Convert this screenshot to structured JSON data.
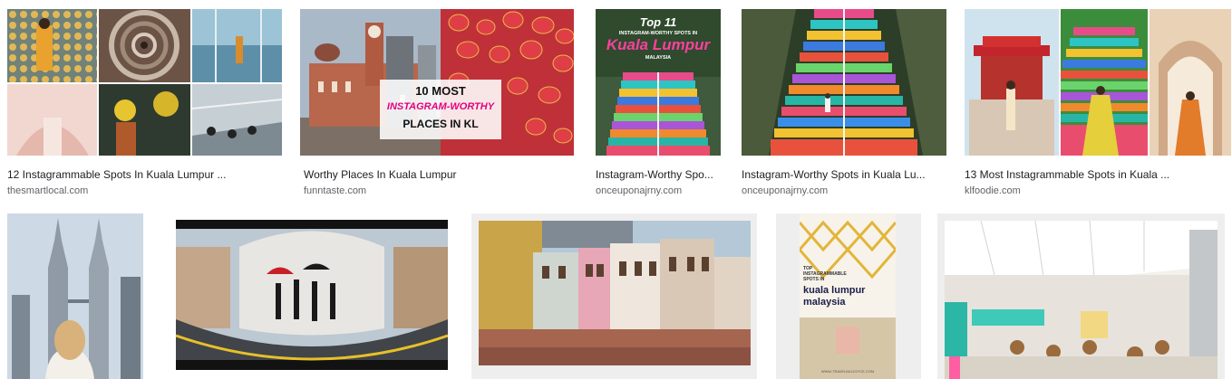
{
  "results": [
    {
      "caption": "12 Instagrammable Spots In Kuala Lumpur ...",
      "source": "thesmartlocal.com"
    },
    {
      "caption": "Worthy Places In Kuala Lumpur",
      "source": "funntaste.com",
      "overlay": {
        "line1": "10 MOST",
        "line2": "INSTAGRAM-WORTHY",
        "line3": "PLACES IN KL"
      }
    },
    {
      "caption": "Instagram-Worthy Spo...",
      "source": "onceuponajrny.com",
      "overlay": {
        "line1": "Top 11",
        "line2": "INSTAGRAM-WORTHY SPOTS IN",
        "line3": "Kuala Lumpur",
        "line4": "MALAYSIA"
      }
    },
    {
      "caption": "Instagram-Worthy Spots in Kuala Lu...",
      "source": "onceuponajrny.com"
    },
    {
      "caption": "13 Most Instagrammable Spots in Kuala ...",
      "source": "klfoodie.com"
    },
    {},
    {},
    {},
    {
      "overlay": {
        "line1": "TOP",
        "line2": "INSTAGRAMMABLE",
        "line3": "SPOTS IN",
        "line4": "kuala lumpur",
        "line5": "malaysia",
        "footer": "WWW.TRAVELINGJOYCE.COM"
      }
    },
    {}
  ],
  "colors": {
    "caption": "#202124",
    "source": "#5f6368",
    "accent_pink": "#e6007e"
  }
}
